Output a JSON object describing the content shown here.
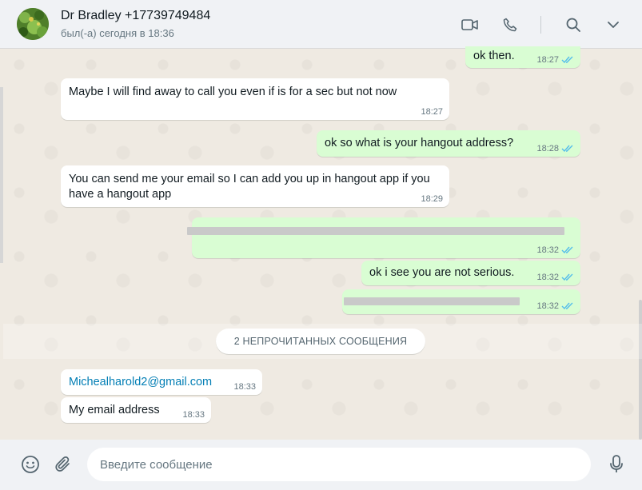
{
  "header": {
    "contact_name": "Dr Bradley +17739749484",
    "status": "был(-а) сегодня в 18:36"
  },
  "messages": [
    {
      "dir": "out",
      "text": "ok then.",
      "time": "18:27",
      "read": true
    },
    {
      "dir": "in",
      "text": "Maybe I will find away to call you even if is for a sec but not now",
      "time": "18:27"
    },
    {
      "dir": "out",
      "text": "ok so what is your hangout address?",
      "time": "18:28",
      "read": true
    },
    {
      "dir": "in",
      "text_line1": "You can send me your email so I can add you up in hangout app if you",
      "text_line2": "have a hangout app",
      "time": "18:29"
    },
    {
      "dir": "out",
      "text": "",
      "redacted": true,
      "time": "18:32",
      "read": true
    },
    {
      "dir": "out",
      "text": "ok i see you are not serious.",
      "time": "18:32",
      "read": true
    },
    {
      "dir": "out",
      "text": "",
      "redacted": true,
      "time": "18:32",
      "read": true
    },
    {
      "dir": "in",
      "text": "Michealharold2@gmail.com",
      "time": "18:33",
      "is_link": true
    },
    {
      "dir": "in",
      "text": "My email address",
      "time": "18:33"
    }
  ],
  "unread_divider": "2 НЕПРОЧИТАННЫХ СООБЩЕНИЯ",
  "composer": {
    "placeholder": "Введите сообщение"
  },
  "colors": {
    "outgoing_bubble": "#d9fdd3",
    "incoming_bubble": "#ffffff",
    "read_ticks": "#53bdeb",
    "chat_bg": "#efeae2"
  }
}
